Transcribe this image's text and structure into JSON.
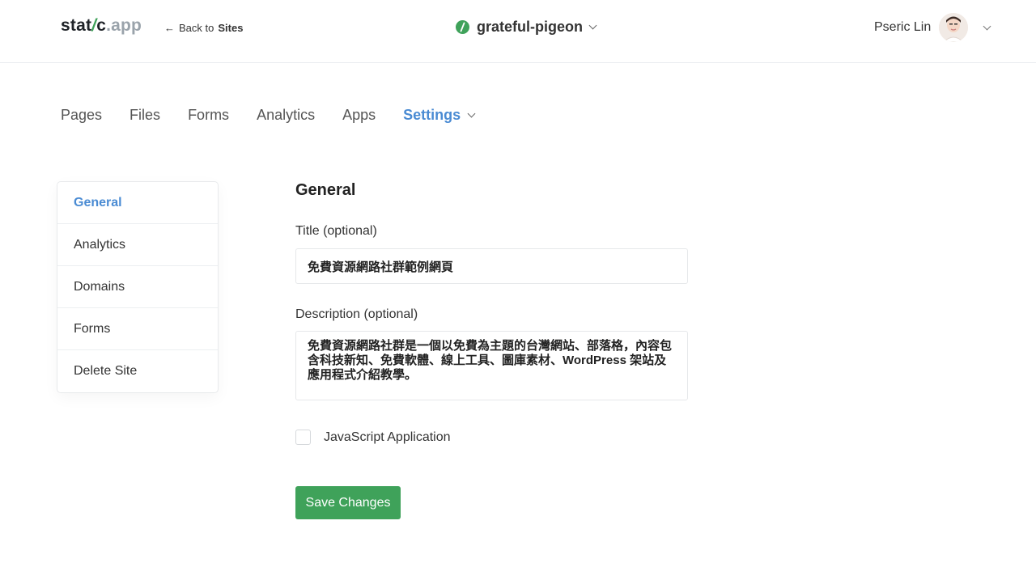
{
  "header": {
    "logo": {
      "part1": "stat",
      "slash": "/",
      "part2": "c",
      "part3": ".app"
    },
    "back_link": {
      "arrow": "←",
      "prefix": "Back to",
      "target": "Sites"
    },
    "site_name": "grateful-pigeon",
    "user_name": "Pseric Lin"
  },
  "tabs": [
    {
      "label": "Pages"
    },
    {
      "label": "Files"
    },
    {
      "label": "Forms"
    },
    {
      "label": "Analytics"
    },
    {
      "label": "Apps"
    },
    {
      "label": "Settings",
      "active": true
    }
  ],
  "sidebar": {
    "items": [
      {
        "label": "General",
        "active": true
      },
      {
        "label": "Analytics"
      },
      {
        "label": "Domains"
      },
      {
        "label": "Forms"
      },
      {
        "label": "Delete Site"
      }
    ]
  },
  "form": {
    "heading": "General",
    "title_label": "Title (optional)",
    "title_value": "免費資源網路社群範例網頁",
    "description_label": "Description (optional)",
    "description_value": "免費資源網路社群是一個以免費為主題的台灣網站、部落格，內容包含科技新知、免費軟體、線上工具、圖庫素材、WordPress 架站及應用程式介紹教學。",
    "js_app_label": "JavaScript Application",
    "js_app_checked": false,
    "save_label": "Save Changes"
  },
  "colors": {
    "brand_green": "#3fa25a",
    "accent_blue": "#4a8bd3"
  }
}
